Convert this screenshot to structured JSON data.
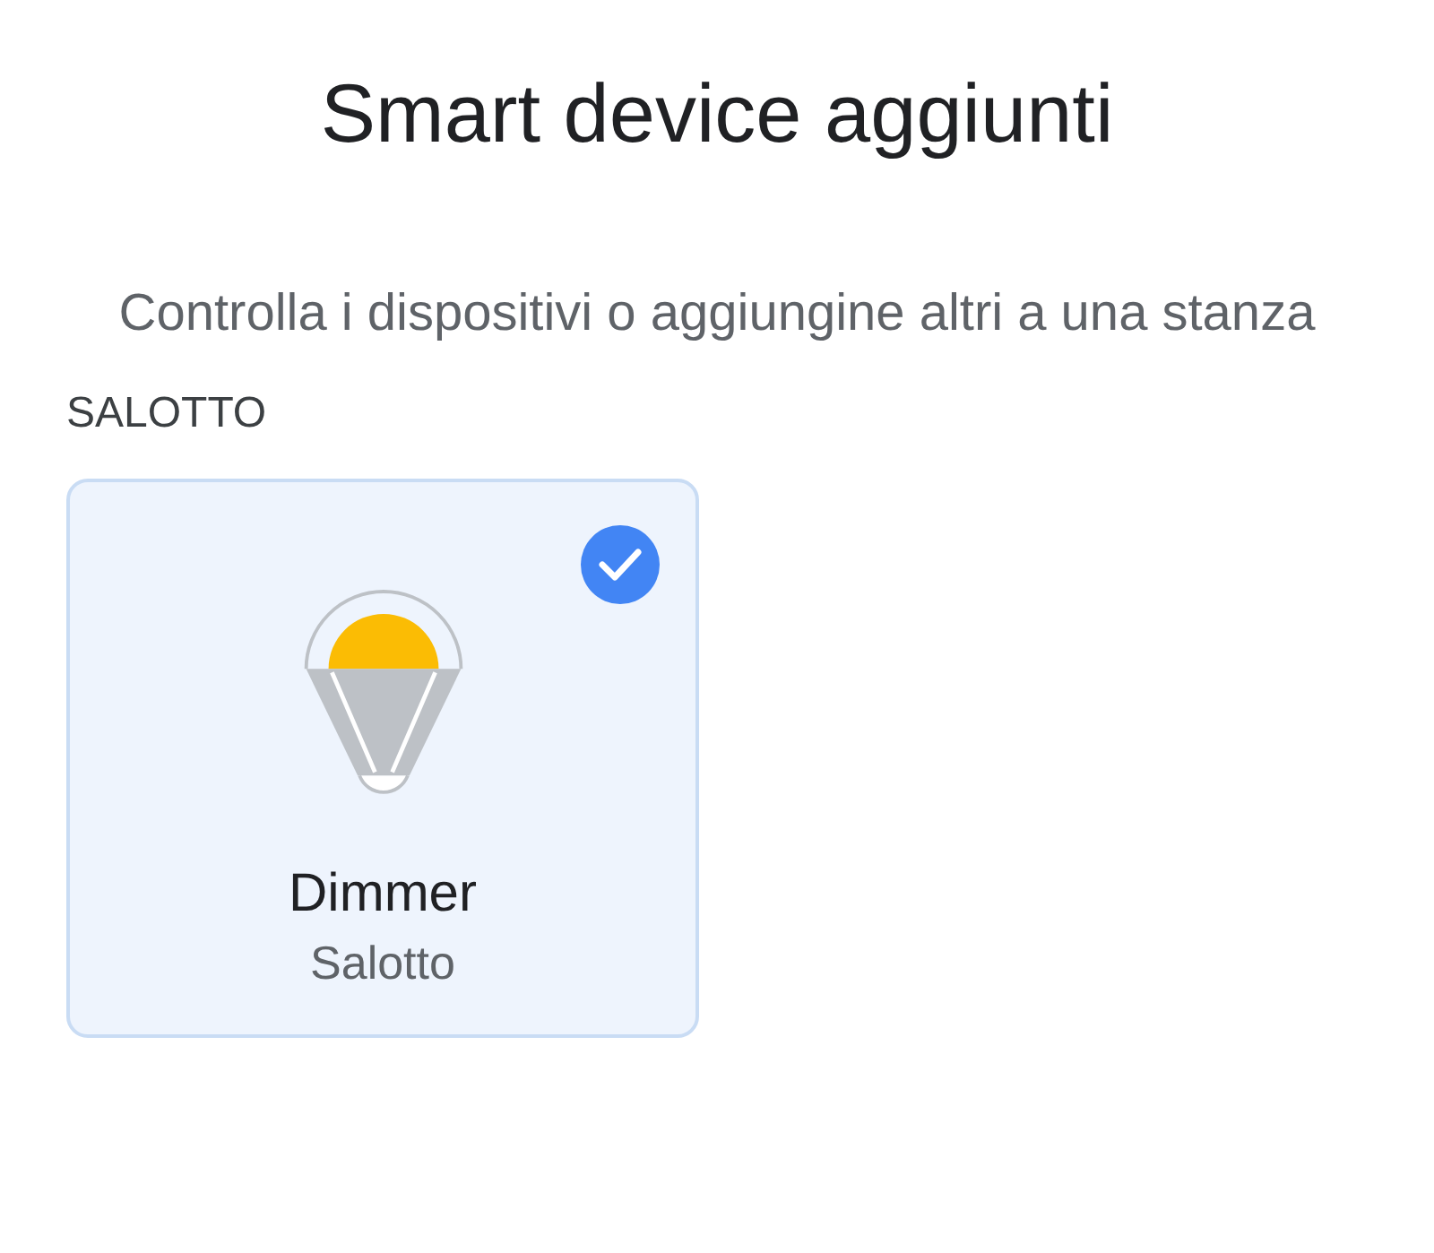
{
  "title": "Smart device aggiunti",
  "subtitle": "Controlla i dispositivi o aggiungine altri a una stanza",
  "rooms": [
    {
      "name": "SALOTTO",
      "devices": [
        {
          "name": "Dimmer",
          "room": "Salotto",
          "selected": true
        }
      ]
    }
  ]
}
